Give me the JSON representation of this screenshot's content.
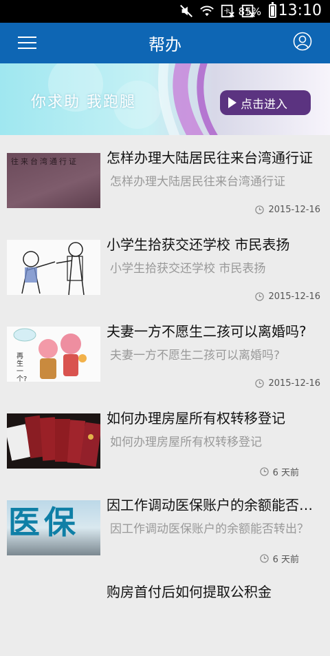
{
  "status_bar": {
    "battery_percent": "85%",
    "battery_level": 0.85,
    "time": "13:10",
    "icons": [
      "mute-icon",
      "wifi-icon",
      "no-sim-icon",
      "no-sim-icon",
      "battery-charging-icon"
    ]
  },
  "app_bar": {
    "title": "帮办",
    "menu_icon": "menu-icon",
    "user_icon": "user-icon"
  },
  "banner": {
    "slogan": "你求助 我跑腿",
    "button_label": "点击进入"
  },
  "articles": [
    {
      "title": "怎样办理大陆居民往来台湾通行证",
      "summary": "怎样办理大陆居民往来台湾通行证",
      "date": "2015-12-16",
      "thumb_caption": "往来台湾通行证"
    },
    {
      "title": "小学生拾获交还学校 市民表扬",
      "summary": "小学生拾获交还学校 市民表扬",
      "date": "2015-12-16"
    },
    {
      "title": "夫妻一方不愿生二孩可以离婚吗?",
      "summary": "夫妻一方不愿生二孩可以离婚吗?",
      "date": "2015-12-16",
      "thumb_caption": "再生一个?"
    },
    {
      "title": "如何办理房屋所有权转移登记",
      "summary": "如何办理房屋所有权转移登记",
      "date": "6 天前"
    },
    {
      "title": "因工作调动医保账户的余额能否转出？",
      "summary": "因工作调动医保账户的余额能否转出？",
      "date": "6 天前",
      "thumb_caption": "医保"
    },
    {
      "title": "购房首付后如何提取公积金",
      "summary": "",
      "date": ""
    }
  ]
}
